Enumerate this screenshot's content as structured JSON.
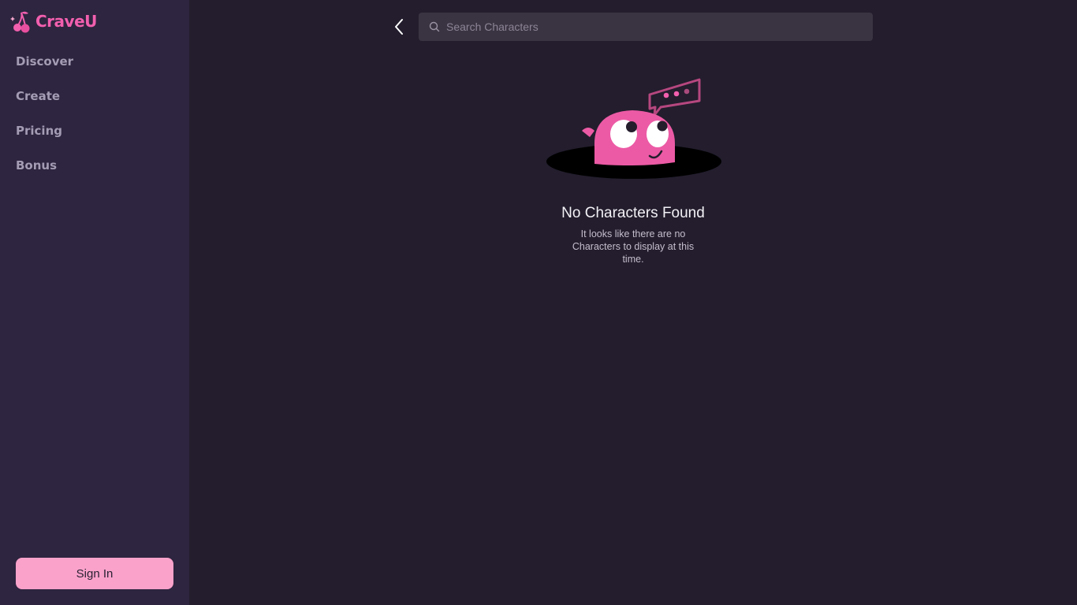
{
  "brand": {
    "name": "CraveU",
    "logo_icon": "cherry-icon",
    "accent": "#f25fae"
  },
  "sidebar": {
    "items": [
      {
        "label": "Discover"
      },
      {
        "label": "Create"
      },
      {
        "label": "Pricing"
      },
      {
        "label": "Bonus"
      }
    ],
    "sign_in_label": "Sign In"
  },
  "header": {
    "back_icon": "chevron-left-icon",
    "search": {
      "placeholder": "Search Characters",
      "value": "",
      "icon": "search-icon"
    }
  },
  "empty_state": {
    "illustration": "blob-peeking-from-hole",
    "title": "No Characters Found",
    "description": "It looks like there are no Characters to display at this time."
  },
  "colors": {
    "background": "#231d2d",
    "sidebar": "#2e2540",
    "search_bg": "#3a3442",
    "button_pink": "#fba2cb"
  }
}
